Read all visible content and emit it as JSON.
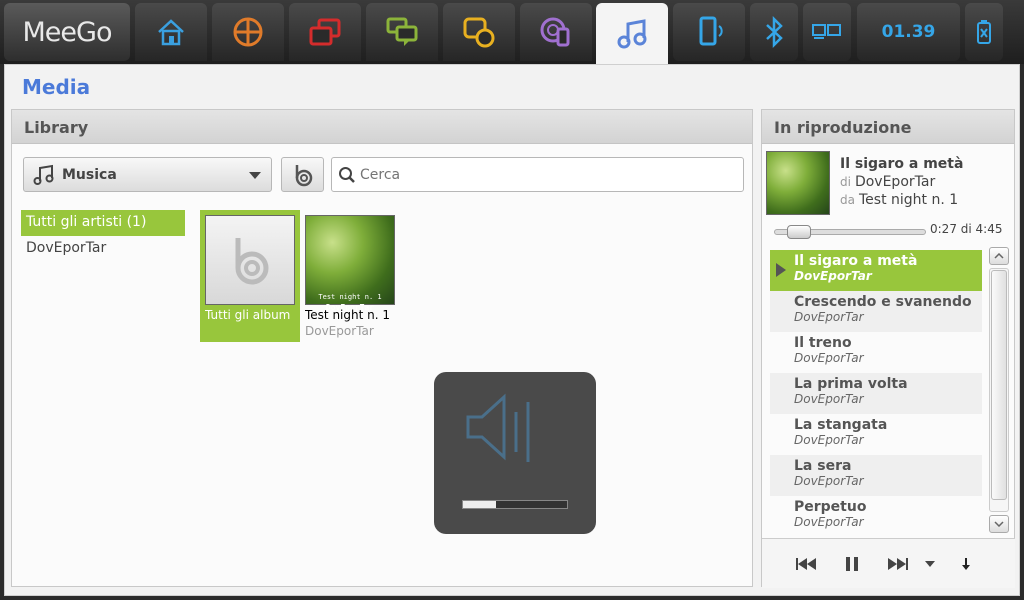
{
  "topbar": {
    "logo": "MeeGo",
    "clock": "01.39",
    "colors": {
      "home": "#3aa0e0",
      "accent_active": "#5b84d8",
      "clock": "#35a6e8",
      "selection": "#98c63c"
    },
    "tabs": [
      {
        "icon": "home-icon"
      },
      {
        "icon": "apps-grid-icon"
      },
      {
        "icon": "windows-icon"
      },
      {
        "icon": "chat-icon"
      },
      {
        "icon": "people-icon"
      },
      {
        "icon": "web-icon"
      },
      {
        "icon": "music-icon",
        "active": true
      },
      {
        "icon": "device-icon"
      },
      {
        "icon": "bluetooth-icon"
      },
      {
        "icon": "display-icon"
      },
      {
        "icon": "battery-icon"
      }
    ]
  },
  "app": {
    "title": "Media",
    "library": {
      "header": "Library",
      "dropdown_label": "Musica",
      "search_placeholder": "Cerca",
      "artists": [
        {
          "label": "Tutti gli artisti (1)",
          "selected": true
        },
        {
          "label": "DovEporTar",
          "selected": false
        }
      ],
      "albums": [
        {
          "name": "Tutti gli album",
          "artist": "",
          "selected": true
        },
        {
          "name": "Test night n. 1",
          "artist": "DovEporTar",
          "selected": false,
          "cover_text": "DovEporTar",
          "cover_subtext": "Test night n. 1"
        }
      ]
    },
    "volume": {
      "level": 0.32
    },
    "now_playing": {
      "header": "In riproduzione",
      "title": "Il sigaro a metà",
      "by_prefix": "di",
      "artist": "DovEporTar",
      "from_prefix": "da",
      "album": "Test night n. 1",
      "time": "0:27 di 4:45",
      "progress": 0.095,
      "tracks": [
        {
          "title": "Il sigaro a metà",
          "artist": "DovEporTar",
          "playing": true
        },
        {
          "title": "Crescendo e svanendo",
          "artist": "DovEporTar"
        },
        {
          "title": "Il treno",
          "artist": "DovEporTar"
        },
        {
          "title": "La prima volta",
          "artist": "DovEporTar"
        },
        {
          "title": "La stangata",
          "artist": "DovEporTar"
        },
        {
          "title": "La sera",
          "artist": "DovEporTar"
        },
        {
          "title": "Perpetuo",
          "artist": "DovEporTar"
        }
      ]
    }
  }
}
